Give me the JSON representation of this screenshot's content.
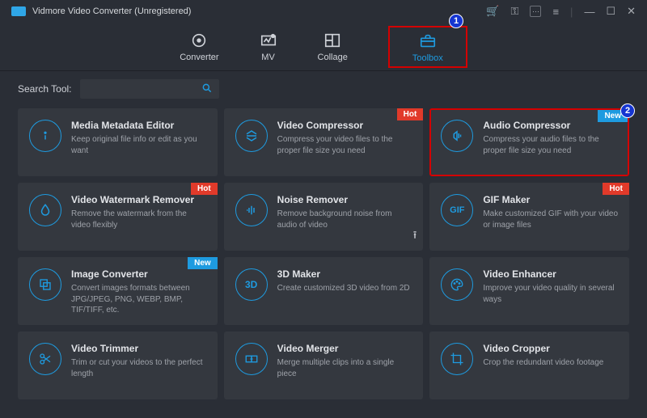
{
  "app": {
    "title": "Vidmore Video Converter (Unregistered)"
  },
  "tabs": {
    "converter": "Converter",
    "mv": "MV",
    "collage": "Collage",
    "toolbox": "Toolbox"
  },
  "search": {
    "label": "Search Tool:",
    "placeholder": ""
  },
  "badges": {
    "hot": "Hot",
    "new": "New"
  },
  "annotations": {
    "n1": "1",
    "n2": "2"
  },
  "tools": {
    "metadata": {
      "title": "Media Metadata Editor",
      "desc": "Keep original file info or edit as you want"
    },
    "vcompress": {
      "title": "Video Compressor",
      "desc": "Compress your video files to the proper file size you need"
    },
    "acompress": {
      "title": "Audio Compressor",
      "desc": "Compress your audio files to the proper file size you need"
    },
    "watermark": {
      "title": "Video Watermark Remover",
      "desc": "Remove the watermark from the video flexibly"
    },
    "noise": {
      "title": "Noise Remover",
      "desc": "Remove background noise from audio of video"
    },
    "gif": {
      "title": "GIF Maker",
      "desc": "Make customized GIF with your video or image files"
    },
    "imgconv": {
      "title": "Image Converter",
      "desc": "Convert images formats between JPG/JPEG, PNG, WEBP, BMP, TIF/TIFF, etc."
    },
    "3d": {
      "title": "3D Maker",
      "desc": "Create customized 3D video from 2D"
    },
    "enhance": {
      "title": "Video Enhancer",
      "desc": "Improve your video quality in several ways"
    },
    "trim": {
      "title": "Video Trimmer",
      "desc": "Trim or cut your videos to the perfect length"
    },
    "merge": {
      "title": "Video Merger",
      "desc": "Merge multiple clips into a single piece"
    },
    "crop": {
      "title": "Video Cropper",
      "desc": "Crop the redundant video footage"
    }
  }
}
